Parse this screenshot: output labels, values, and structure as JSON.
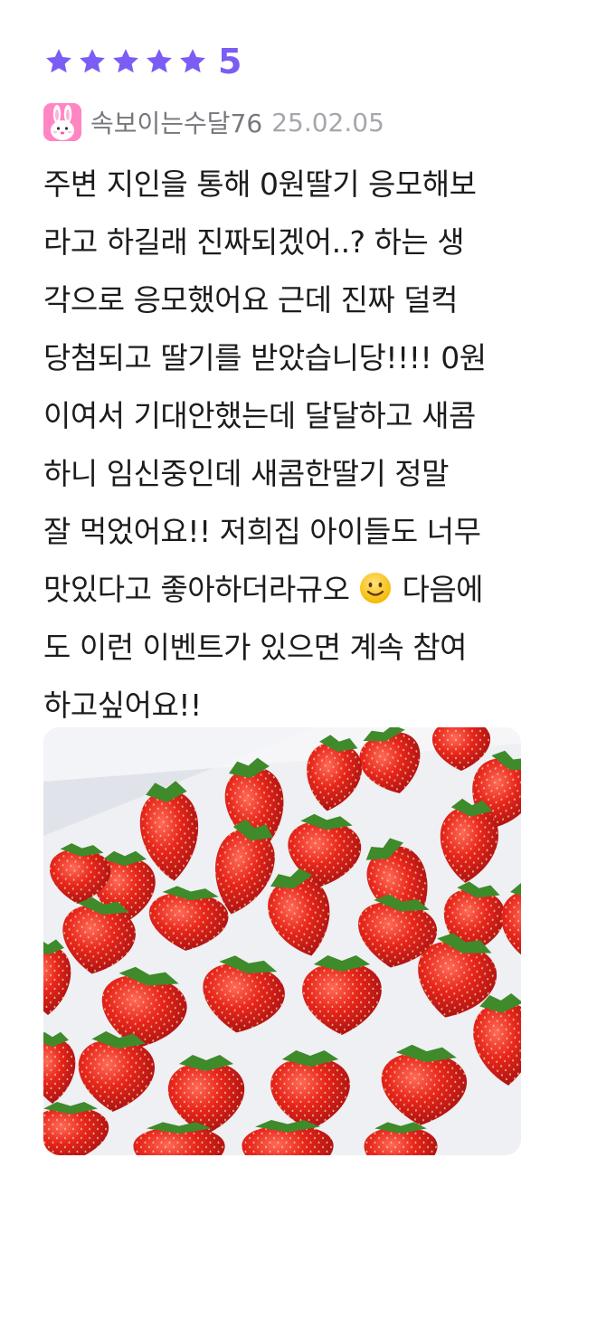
{
  "review": {
    "rating_value": "5",
    "star_count": 5,
    "accent_color": "#7b5cf5",
    "author": {
      "name": "속보이는수달76",
      "avatar_icon": "bunny-avatar-icon"
    },
    "date": "25.02.05",
    "body_lines": [
      "주변 지인을 통해 0원딸기 응모해보",
      "라고 하길래 진짜되겠어..? 하는 생",
      "각으로 응모했어요 근데 진짜 덜컥",
      "당첨되고 딸기를 받았습니당!!!! 0원",
      "이여서 기대안했는데 달달하고 새콤",
      "하니 임신중인데 새콤한딸기 정말",
      "잘 먹었어요!! 저희집 아이들도 너무",
      "맛있다고 좋아하더라규오",
      "다음에",
      "도 이런 이벤트가 있으면 계속 참여",
      "하고싶어요!!"
    ],
    "emoji_icon": "slightly-smiling-face-icon",
    "photo": {
      "subject": "strawberries-in-tray-photo"
    }
  }
}
